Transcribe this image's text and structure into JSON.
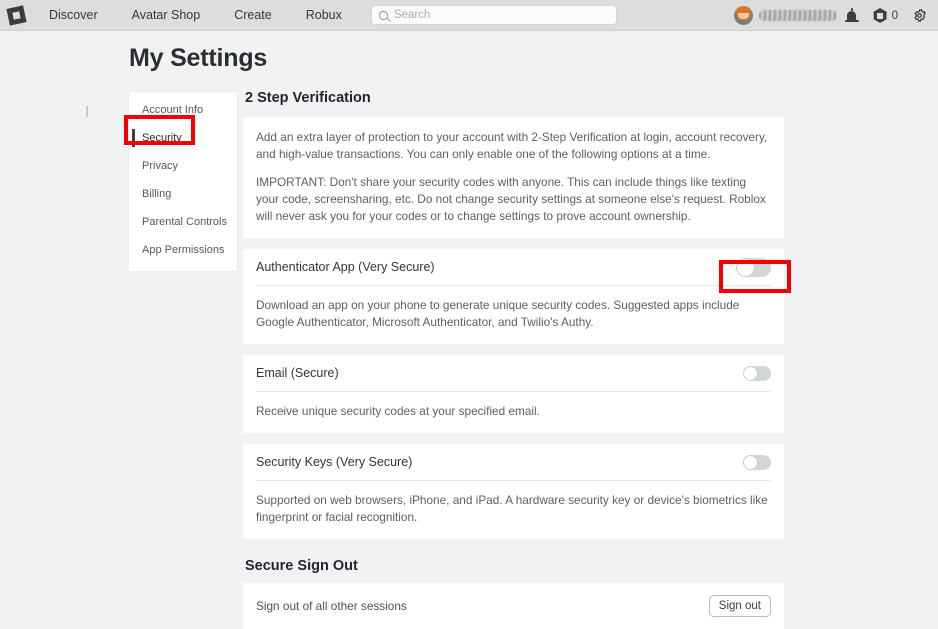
{
  "nav": {
    "logo_icon": "roblox-logo-icon",
    "links": [
      {
        "label": "Discover"
      },
      {
        "label": "Avatar Shop"
      },
      {
        "label": "Create"
      },
      {
        "label": "Robux"
      }
    ],
    "search": {
      "placeholder": "Search",
      "value": "",
      "icon": "search-icon"
    },
    "avatar_icon": "avatar",
    "username": "",
    "username_redacted": true,
    "bell_icon": "notification-bell-icon",
    "robux": {
      "icon": "robux-icon",
      "count": "0"
    },
    "gear_icon": "gear-icon"
  },
  "page": {
    "title": "My Settings"
  },
  "sidebar": {
    "items": [
      {
        "label": "Account Info",
        "active": false
      },
      {
        "label": "Security",
        "active": true
      },
      {
        "label": "Privacy",
        "active": false
      },
      {
        "label": "Billing",
        "active": false
      },
      {
        "label": "Parental Controls",
        "active": false
      },
      {
        "label": "App Permissions",
        "active": false
      }
    ]
  },
  "main": {
    "two_step": {
      "title": "2 Step Verification",
      "intro_paragraph_1": "Add an extra layer of protection to your account with 2-Step Verification at login, account recovery, and high-value transactions. You can only enable one of the following options at a time.",
      "intro_paragraph_2": "IMPORTANT: Don't share your security codes with anyone. This can include things like texting your code, screensharing, etc. Do not change security settings at someone else's request. Roblox will never ask you for your codes or to change settings to prove account ownership.",
      "options": [
        {
          "label": "Authenticator App (Very Secure)",
          "toggle_state": "off",
          "description": "Download an app on your phone to generate unique security codes. Suggested apps include Google Authenticator, Microsoft Authenticator, and Twilio's Authy."
        },
        {
          "label": "Email (Secure)",
          "toggle_state": "off",
          "description": "Receive unique security codes at your specified email."
        },
        {
          "label": "Security Keys (Very Secure)",
          "toggle_state": "off",
          "description": "Supported on web browsers, iPhone, and iPad. A hardware security key or device's biometrics like fingerprint or facial recognition."
        }
      ]
    },
    "secure_sign_out": {
      "title": "Secure Sign Out",
      "row_label": "Sign out of all other sessions",
      "button_label": "Sign out"
    }
  },
  "annotations": {
    "highlight_color": "#f90000",
    "boxes": [
      {
        "target": "sidebar-item-security"
      },
      {
        "target": "authenticator-app-toggle"
      }
    ]
  },
  "colors": {
    "nav_background": "#dddddd",
    "page_background": "#f1f2f4",
    "card_background": "#ffffff",
    "text_primary": "#2b2e30",
    "text_secondary": "#5b6065",
    "toggle_off": "#d2d6d9"
  }
}
